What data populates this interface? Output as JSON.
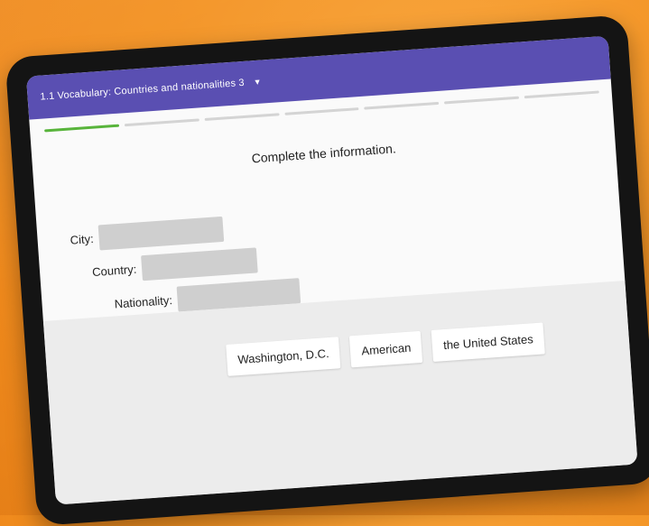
{
  "header": {
    "title": "1.1 Vocabulary: Countries and nationalities 3",
    "dropdown_icon": "caret-down-icon"
  },
  "progress": {
    "total_steps": 7,
    "current_step": 1
  },
  "instruction": "Complete the information.",
  "fields": [
    {
      "label": "City:",
      "value": ""
    },
    {
      "label": "Country:",
      "value": ""
    },
    {
      "label": "Nationality:",
      "value": ""
    }
  ],
  "word_bank": [
    "Washington, D.C.",
    "American",
    "the United States"
  ],
  "colors": {
    "header_bg": "#5a4fb2",
    "progress_active": "#58b43b",
    "background": "#f39222"
  }
}
